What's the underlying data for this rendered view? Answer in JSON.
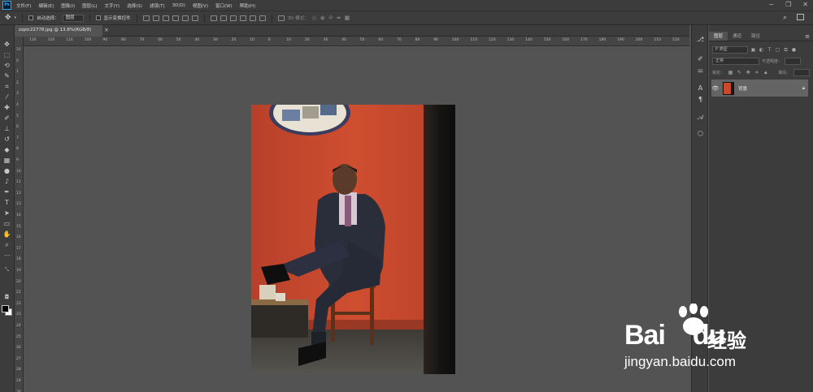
{
  "menubar": {
    "logo": "Ps",
    "items": [
      "文件(F)",
      "编辑(E)",
      "图像(I)",
      "图层(L)",
      "文字(Y)",
      "选择(S)",
      "滤镜(T)",
      "3D(D)",
      "视图(V)",
      "窗口(W)",
      "帮助(H)"
    ],
    "window_controls": [
      "−",
      "❐",
      "✕"
    ]
  },
  "options": {
    "auto_select_label": "自动选择：",
    "auto_select_value": "图层",
    "show_transform_label": "显示变换控件",
    "mode_3d_label": "3D 模式："
  },
  "document": {
    "tab_title": "zzpic22778.jpg @ 13.8%(RGB/8)",
    "tab_close": "×"
  },
  "rulers": {
    "horizontal": [
      "130",
      "120",
      "110",
      "100",
      "90",
      "80",
      "70",
      "60",
      "50",
      "40",
      "30",
      "20",
      "10",
      "0",
      "10",
      "20",
      "30",
      "40",
      "50",
      "60",
      "70",
      "80",
      "90",
      "100",
      "110",
      "120",
      "130",
      "140",
      "150",
      "160",
      "170",
      "180",
      "190",
      "200",
      "210",
      "220"
    ],
    "vertical": [
      "10",
      "0",
      "1",
      "2",
      "3",
      "4",
      "5",
      "6",
      "7",
      "8",
      "9",
      "10",
      "11",
      "12",
      "13",
      "14",
      "15",
      "16",
      "17",
      "18",
      "19",
      "20",
      "21",
      "22",
      "23",
      "24",
      "25",
      "26",
      "27",
      "28",
      "29",
      "30"
    ]
  },
  "layers_panel": {
    "tabs": [
      "图层",
      "通道",
      "路径"
    ],
    "kind_placeholder": "P 类型",
    "blend_mode": "正常",
    "opacity_label": "不透明度：",
    "lock_label": "锁定：",
    "fill_label": "填充：",
    "layers": [
      {
        "name": "背景",
        "visible": true,
        "locked": true
      }
    ]
  },
  "icons": {
    "tools": [
      "move-icon",
      "marquee-icon",
      "lasso-icon",
      "quick-select-icon",
      "crop-icon",
      "eyedropper-icon",
      "healing-icon",
      "brush-icon",
      "stamp-icon",
      "history-brush-icon",
      "eraser-icon",
      "gradient-icon",
      "blur-icon",
      "dodge-icon",
      "pen-icon",
      "type-icon",
      "path-select-icon",
      "rectangle-icon",
      "hand-icon",
      "zoom-icon",
      "more-icon"
    ],
    "panel_strip": [
      "history-icon",
      "brush-settings-icon",
      "adjust-icon",
      "character-icon",
      "paragraph-icon",
      "glyphs-icon",
      "3d-icon"
    ]
  },
  "watermark": {
    "brand": "Bai",
    "brand_tail": "du",
    "chinese": "经验",
    "url": "jingyan.baidu.com"
  },
  "colors": {
    "ui_dark": "#3c3c3c",
    "canvas": "#535353",
    "accent": "#31a8ff",
    "wall_red": "#c9492c"
  }
}
